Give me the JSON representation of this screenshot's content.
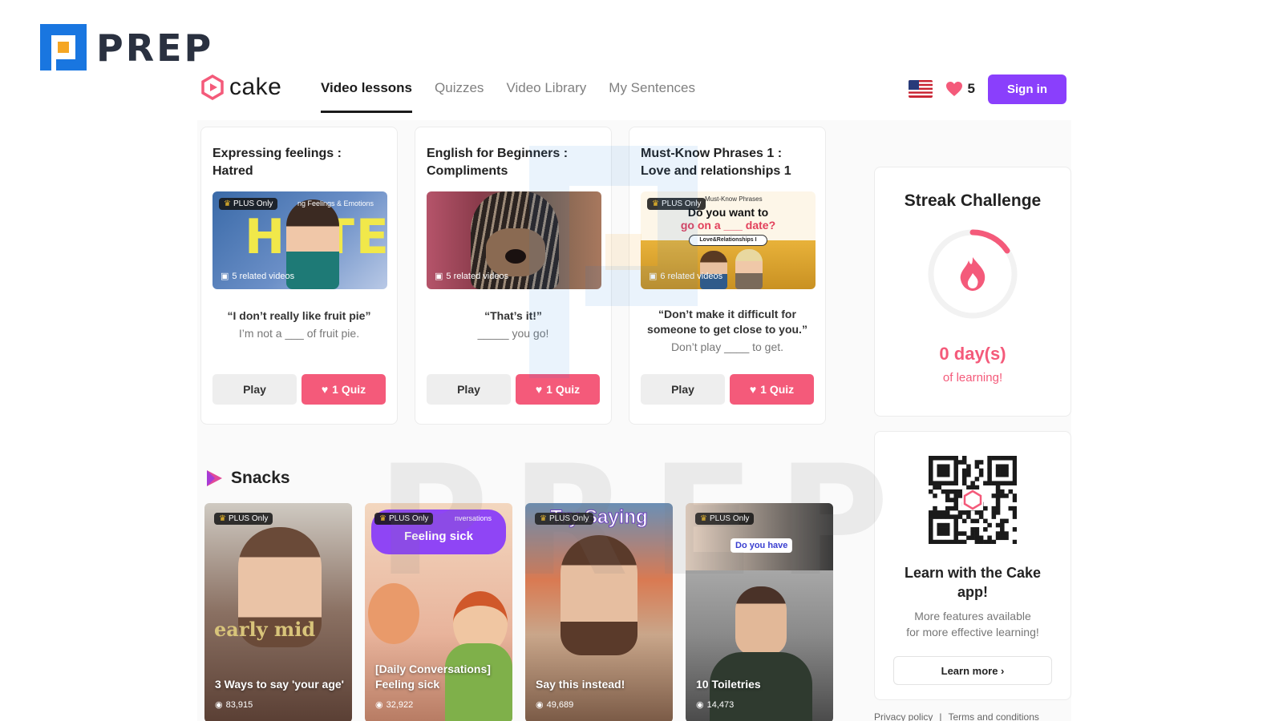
{
  "watermark": {
    "brand": "PREP"
  },
  "header": {
    "brand": "cake",
    "nav": [
      "Video lessons",
      "Quizzes",
      "Video Library",
      "My Sentences"
    ],
    "hearts_count": "5",
    "signin_label": "Sign in"
  },
  "lessons": [
    {
      "title": "Expressing feelings : Hatred",
      "badge": "PLUS Only",
      "thumb_text": "HATE",
      "thumb_caption": "ng Feelings & Emotions",
      "related": "5 related videos",
      "quote": "“I don’t really like fruit pie”",
      "sub": "I’m not a ___ of fruit pie.",
      "play": "Play",
      "quiz": "1 Quiz"
    },
    {
      "title": "English for Beginners : Compliments",
      "badge": "",
      "related": "5 related videos",
      "quote": "“That’s it!”",
      "sub": "_____ you go!",
      "play": "Play",
      "quiz": "1 Quiz"
    },
    {
      "title": "Must-Know Phrases 1 : Love and relationships 1",
      "badge": "PLUS Only",
      "thumb_caption": "Must-Know Phrases",
      "thumb_line1": "Do you want to",
      "thumb_line2": "go on a ___ date?",
      "thumb_pill": "Love&Relationships I",
      "related": "6 related videos",
      "quote": "“Don’t make it difficult for someone to get close to you.”",
      "sub": "Don’t play ____ to get.",
      "play": "Play",
      "quiz": "1 Quiz"
    }
  ],
  "streak": {
    "title": "Streak Challenge",
    "days": "0 day(s)",
    "sub": "of learning!"
  },
  "app_promo": {
    "title": "Learn with the Cake app!",
    "sub_line1": "More features available",
    "sub_line2": "for more effective learning!",
    "button": "Learn more ›"
  },
  "footer": {
    "privacy": "Privacy policy",
    "separator": "|",
    "terms": "Terms and conditions"
  },
  "snacks": {
    "title": "Snacks",
    "items": [
      {
        "title": "3 Ways to say 'your age'",
        "views": "83,915",
        "badge": "PLUS Only",
        "overlay": "early mid"
      },
      {
        "title": "[Daily Conversations] Feeling sick",
        "views": "32,922",
        "badge": "PLUS Only",
        "overlay": "Feeling sick",
        "overlay_small": "nversations"
      },
      {
        "title": "Say this instead!",
        "views": "49,689",
        "badge": "PLUS Only",
        "overlay": "Try Saying"
      },
      {
        "title": "10 Toiletries",
        "views": "14,473",
        "badge": "PLUS Only",
        "overlay": "Do you have"
      }
    ]
  },
  "colors": {
    "accent": "#8a3ffc",
    "pink": "#f45a7a",
    "prep_blue": "#1976e0"
  }
}
